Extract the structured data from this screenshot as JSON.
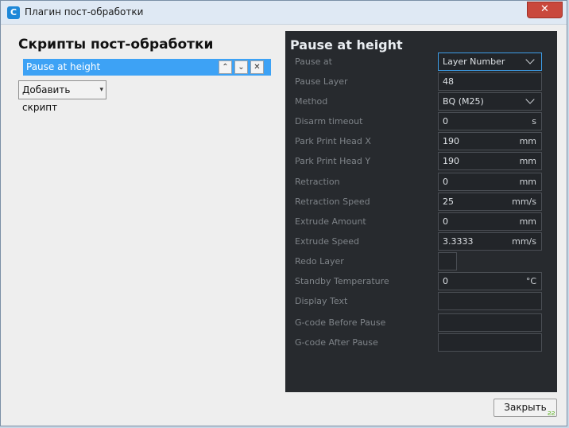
{
  "window": {
    "title": "Плагин пост-обработки",
    "app_icon": "C",
    "close_symbol": "✕"
  },
  "left": {
    "title": "Скрипты пост-обработки",
    "scripts": [
      {
        "label": "Pause at height",
        "selected": true
      }
    ],
    "move_up_symbol": "⌃",
    "move_down_symbol": "⌄",
    "remove_symbol": "✕",
    "add_button": "Добавить скрипт",
    "add_arrow": "▾"
  },
  "settings": {
    "title": "Pause at height",
    "rows": [
      {
        "label": "Pause at",
        "type": "combo",
        "value": "Layer Number",
        "active": true
      },
      {
        "label": "Pause Layer",
        "type": "text",
        "value": "48"
      },
      {
        "label": "Method",
        "type": "combo",
        "value": "BQ (M25)"
      },
      {
        "label": "Disarm timeout",
        "type": "text",
        "value": "0",
        "unit": "s"
      },
      {
        "label": "Park Print Head X",
        "type": "text",
        "value": "190",
        "unit": "mm"
      },
      {
        "label": "Park Print Head Y",
        "type": "text",
        "value": "190",
        "unit": "mm"
      },
      {
        "label": "Retraction",
        "type": "text",
        "value": "0",
        "unit": "mm"
      },
      {
        "label": "Retraction Speed",
        "type": "text",
        "value": "25",
        "unit": "mm/s"
      },
      {
        "label": "Extrude Amount",
        "type": "text",
        "value": "0",
        "unit": "mm"
      },
      {
        "label": "Extrude Speed",
        "type": "text",
        "value": "3.3333",
        "unit": "mm/s"
      },
      {
        "label": "Redo Layer",
        "type": "checkbox",
        "checked": false
      },
      {
        "label": "Standby Temperature",
        "type": "text",
        "value": "0",
        "unit": "°C"
      },
      {
        "label": "Display Text",
        "type": "text",
        "value": ""
      },
      {
        "label": "G-code Before Pause",
        "type": "text",
        "value": ""
      },
      {
        "label": "G-code After Pause",
        "type": "text",
        "value": ""
      }
    ]
  },
  "footer": {
    "close_button": "Закрыть",
    "grip": "ƨƨ"
  }
}
